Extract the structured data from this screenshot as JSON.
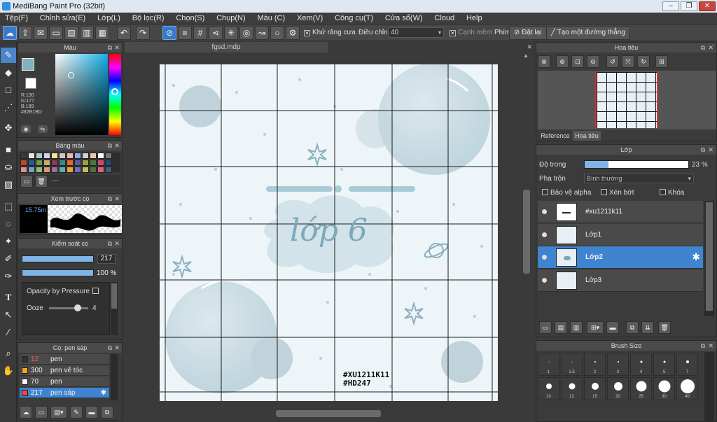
{
  "window": {
    "title": "MediBang Paint Pro (32bit)",
    "min": "–",
    "max": "❐",
    "close": "✕"
  },
  "menu": [
    "Tệp(F)",
    "Chỉnh sửa(E)",
    "Lớp(L)",
    "Bộ lọc(R)",
    "Chọn(S)",
    "Chụp(N)",
    "Màu (C)",
    "Xem(V)",
    "Công cụ(T)",
    "Cửa sổ(W)",
    "Cloud",
    "Help"
  ],
  "toolbar": {
    "antialias_label": "Khử răng cưa",
    "adjust_label": "Điều chỉnh",
    "adjust_value": "40",
    "soft_edge_label": "Cạnh mềm",
    "key_label": "Phím",
    "reset_label": "Đặt lại",
    "straight_line_label": "Tạo một đường thẳng"
  },
  "color_panel": {
    "title": "Màu",
    "r": "R:130",
    "g": "G:177",
    "b": "B:189",
    "hex": "#82B1BD",
    "primary_color": "#82b1bd",
    "secondary_color": "#ffffff"
  },
  "palette_panel": {
    "title": "Bảng màu",
    "colors": [
      "#3a3a3a",
      "#f0e6d8",
      "#9ed2c9",
      "#d8d0f0",
      "#f6e58a",
      "#c9c9c9",
      "#f5b4b4",
      "#8cb0e6",
      "#d0d0d0",
      "#f3c4a3",
      "#ffffff",
      "#777777",
      "#b84a2a",
      "#2a5a8a",
      "#6a9a4a",
      "#c8b060",
      "#8a3a5a",
      "#3a8a8a",
      "#e06a2a",
      "#5a5aa0",
      "#a0a040",
      "#4a7a3a",
      "#d04a6a",
      "#2a4a6a",
      "#e09090",
      "#70a0d0",
      "#90c070",
      "#d0a070",
      "#a070a0",
      "#60b0b0",
      "#f0a040",
      "#7070c0",
      "#c0c060",
      "#507040",
      "#e06080",
      "#406080"
    ],
    "bar_text": "---"
  },
  "brush_preview": {
    "title": "Xem trước cọ",
    "size": "15.75m"
  },
  "brush_control": {
    "title": "Kiểm soát cọ",
    "size_value": "217",
    "opacity_value": "100 %",
    "pressure_label": "Opacity by Pressure",
    "ooze_label": "Ooze",
    "ooze_value": "4"
  },
  "brush_list": {
    "title": "Cọ: pen sáp",
    "items": [
      {
        "num": "12",
        "name": "pen",
        "color": "#333333"
      },
      {
        "num": "300",
        "name": "pen vẽ tóc",
        "color": "#f5a623"
      },
      {
        "num": "70",
        "name": "pen",
        "color": "#ffffff"
      },
      {
        "num": "217",
        "name": "pen sáp",
        "color": "#e84a4a"
      }
    ]
  },
  "document": {
    "tab": "fgsd.mdp",
    "title_text": "lớp 6",
    "credit_line1": "#XU1211K11",
    "credit_line2": "#HD247"
  },
  "navigator": {
    "title": "Hoa tiêu",
    "tab_reference": "Reference",
    "tab_navigator": "Hoa tiêu"
  },
  "layer_panel": {
    "title": "Lớp",
    "opacity_label": "Độ trong",
    "opacity_value": "23 %",
    "opacity_level": 23,
    "blend_label": "Pha trộn",
    "blend_value": "Bình thường",
    "protect_alpha": "Bảo vệ alpha",
    "clipping": "Xén bớt",
    "lock": "Khóa",
    "layers": [
      "#xu1211k11",
      "Lớp1",
      "Lớp2",
      "Lớp3"
    ],
    "selected_layer": "Lớp2"
  },
  "brush_size": {
    "title": "Brush Size",
    "sizes": [
      "1",
      "1.5",
      "2",
      "3",
      "4",
      "5",
      "7",
      "10",
      "12",
      "15",
      "20",
      "25",
      "30",
      "40"
    ],
    "dot_sizes": [
      1,
      1,
      2,
      2,
      3,
      3,
      4,
      8,
      9,
      10,
      12,
      15,
      17,
      20
    ]
  },
  "accent": "#3f84cf"
}
